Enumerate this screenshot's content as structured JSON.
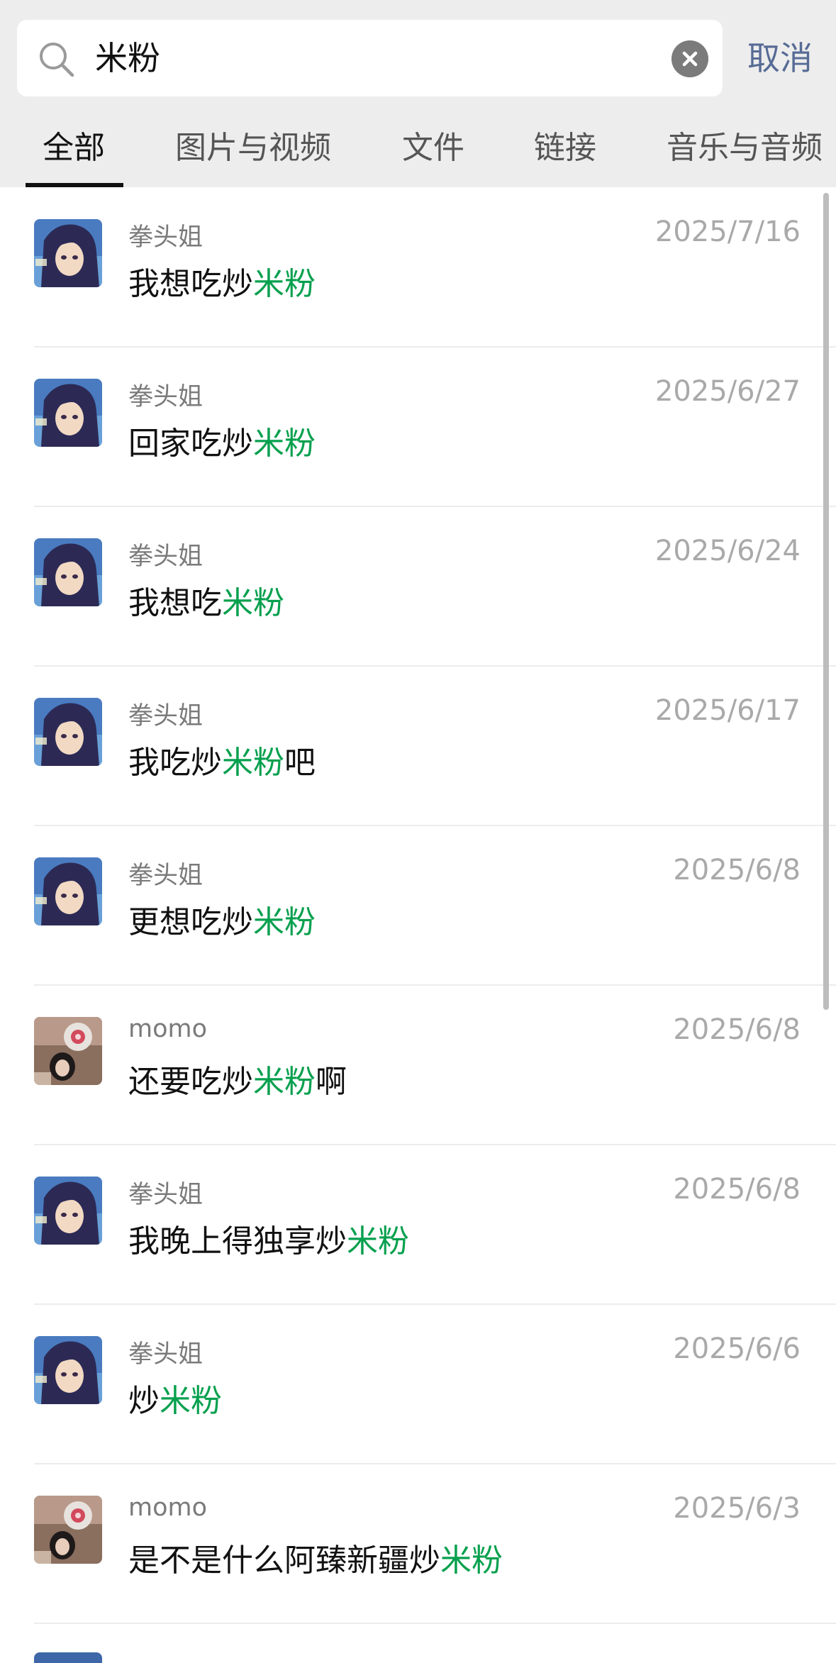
{
  "search": {
    "query": "米粉",
    "cancel_label": "取消"
  },
  "tabs": [
    {
      "label": "全部",
      "active": true
    },
    {
      "label": "图片与视频"
    },
    {
      "label": "文件"
    },
    {
      "label": "链接"
    },
    {
      "label": "音乐与音频"
    }
  ],
  "results": [
    {
      "sender": "拳头姐",
      "date": "2025/7/16",
      "pre": "我想吃炒",
      "hl": "米粉",
      "post": "",
      "avatar": "anime"
    },
    {
      "sender": "拳头姐",
      "date": "2025/6/27",
      "pre": "回家吃炒",
      "hl": "米粉",
      "post": "",
      "avatar": "anime"
    },
    {
      "sender": "拳头姐",
      "date": "2025/6/24",
      "pre": "我想吃",
      "hl": "米粉",
      "post": "",
      "avatar": "anime"
    },
    {
      "sender": "拳头姐",
      "date": "2025/6/17",
      "pre": "我吃炒",
      "hl": "米粉",
      "post": "吧",
      "avatar": "anime"
    },
    {
      "sender": "拳头姐",
      "date": "2025/6/8",
      "pre": "更想吃炒",
      "hl": "米粉",
      "post": "",
      "avatar": "anime"
    },
    {
      "sender": "momo",
      "date": "2025/6/8",
      "pre": "还要吃炒",
      "hl": "米粉",
      "post": "啊",
      "avatar": "photo"
    },
    {
      "sender": "拳头姐",
      "date": "2025/6/8",
      "pre": "我晚上得独享炒",
      "hl": "米粉",
      "post": "",
      "avatar": "anime"
    },
    {
      "sender": "拳头姐",
      "date": "2025/6/6",
      "pre": "炒",
      "hl": "米粉",
      "post": "",
      "avatar": "anime"
    },
    {
      "sender": "momo",
      "date": "2025/6/3",
      "pre": "是不是什么阿臻新疆炒",
      "hl": "米粉",
      "post": "",
      "avatar": "photo"
    }
  ],
  "colors": {
    "highlight": "#07a04e",
    "cancel": "#576b95",
    "header_bg": "#ededed"
  }
}
